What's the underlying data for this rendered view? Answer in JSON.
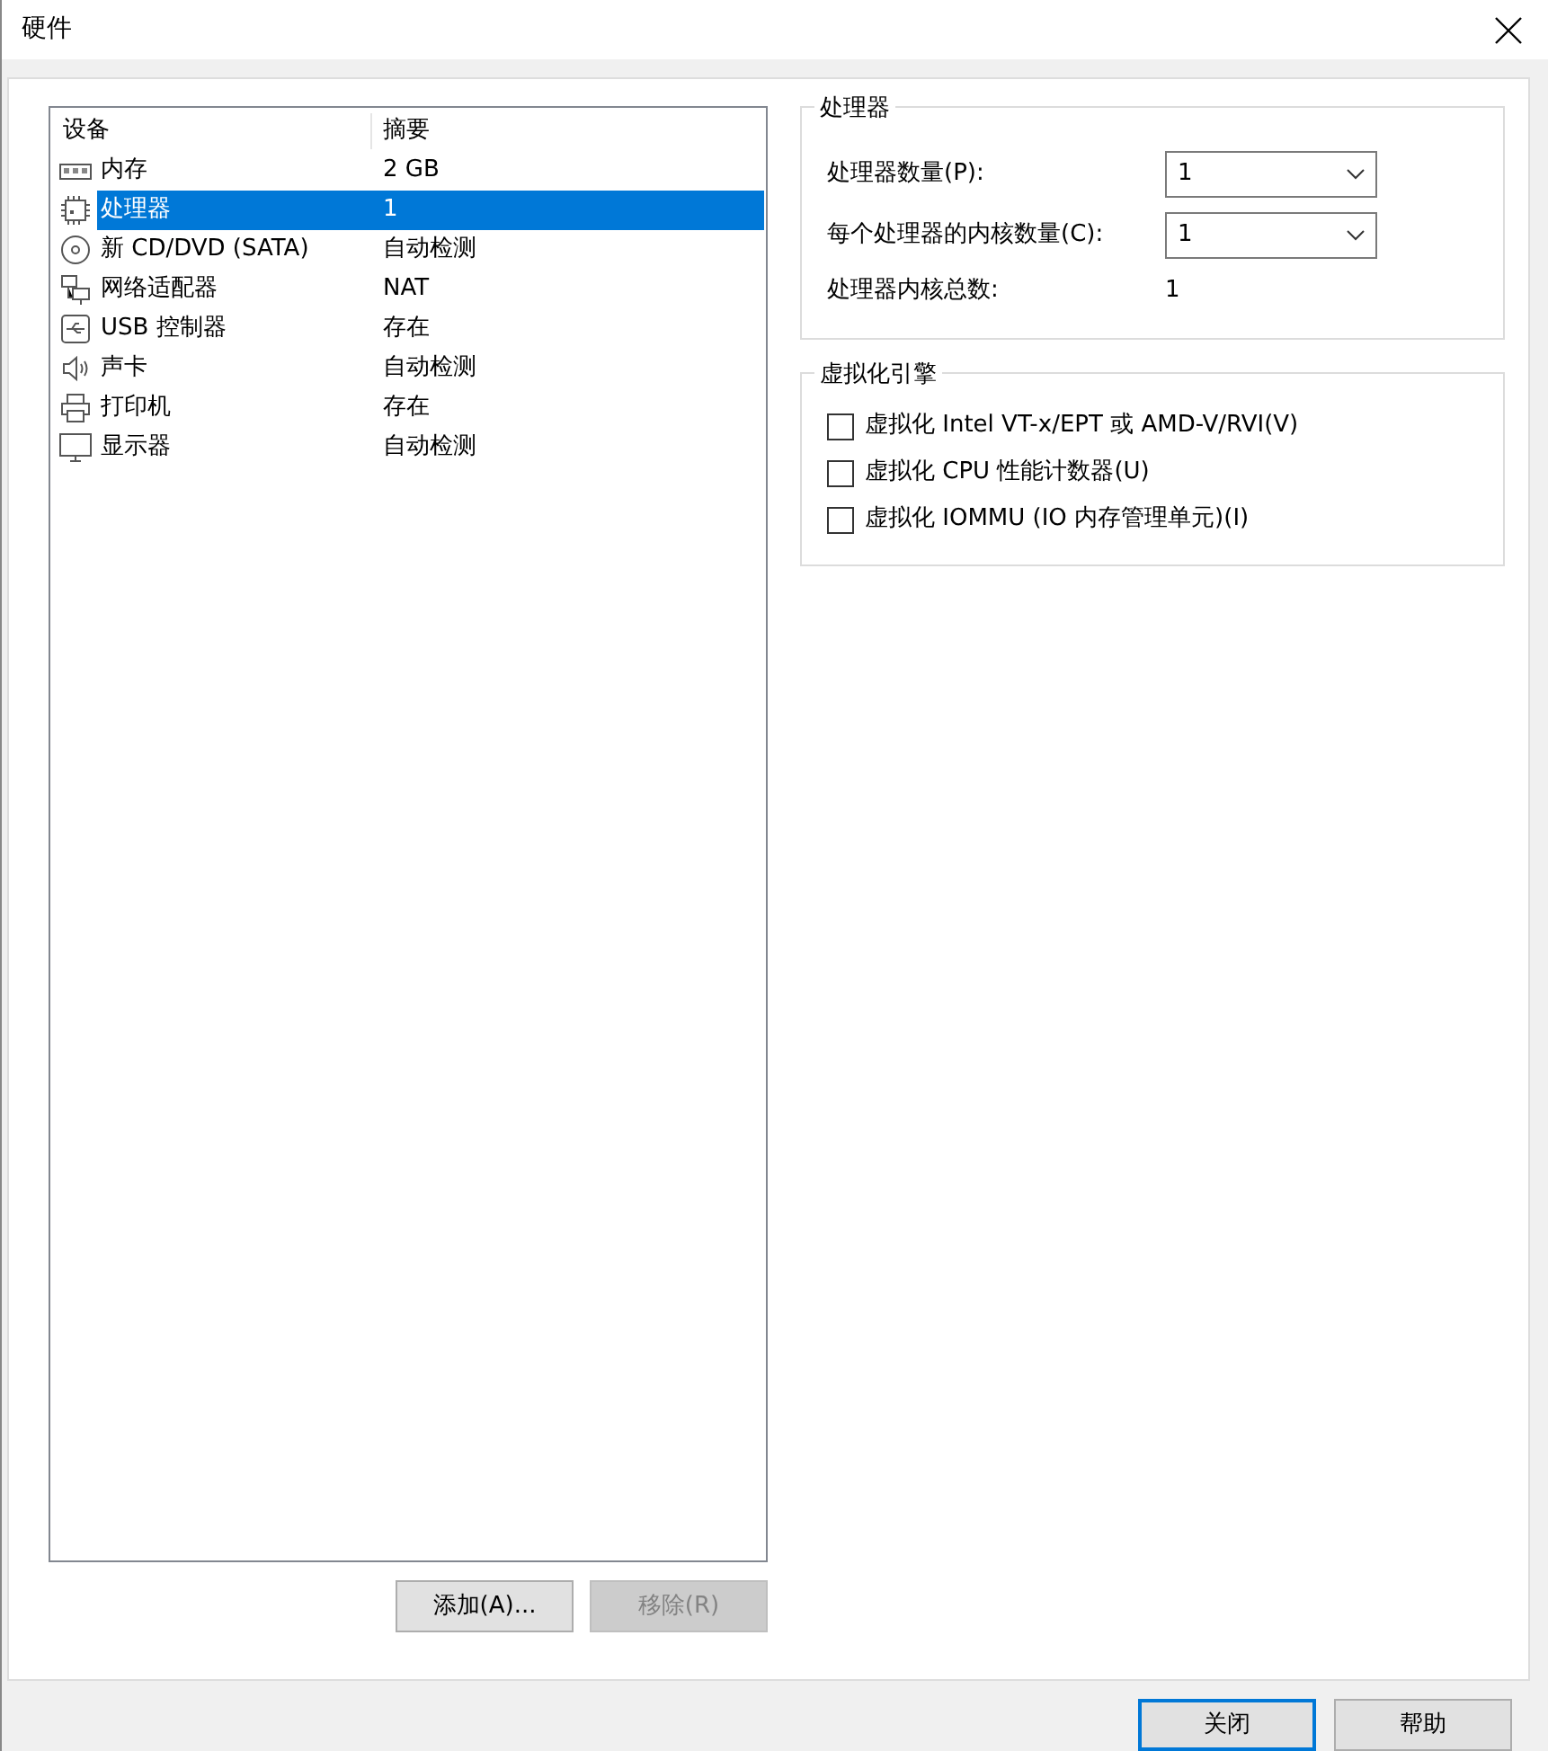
{
  "window": {
    "title": "硬件"
  },
  "devices": {
    "columns": [
      "设备",
      "摘要"
    ],
    "rows": [
      {
        "kind": "memory",
        "name": "内存",
        "summary": "2 GB",
        "selected": false
      },
      {
        "kind": "cpu",
        "name": "处理器",
        "summary": "1",
        "selected": true
      },
      {
        "kind": "disc",
        "name": "新 CD/DVD (SATA)",
        "summary": "自动检测",
        "selected": false
      },
      {
        "kind": "network",
        "name": "网络适配器",
        "summary": "NAT",
        "selected": false
      },
      {
        "kind": "usb",
        "name": "USB 控制器",
        "summary": "存在",
        "selected": false
      },
      {
        "kind": "sound",
        "name": "声卡",
        "summary": "自动检测",
        "selected": false
      },
      {
        "kind": "printer",
        "name": "打印机",
        "summary": "存在",
        "selected": false
      },
      {
        "kind": "display",
        "name": "显示器",
        "summary": "自动检测",
        "selected": false
      }
    ]
  },
  "list_buttons": [
    {
      "label": "添加(A)...",
      "disabled": false
    },
    {
      "label": "移除(R)",
      "disabled": true
    }
  ],
  "processor_group": {
    "title": "处理器",
    "selects": [
      {
        "label": "处理器数量(P):",
        "value": "1"
      },
      {
        "label": "每个处理器的内核数量(C):",
        "value": "1"
      }
    ],
    "total": {
      "label": "处理器内核总数:",
      "value": "1"
    }
  },
  "virtualization_group": {
    "title": "虚拟化引擎",
    "options": [
      {
        "label": "虚拟化 Intel VT-x/EPT 或 AMD-V/RVI(V)",
        "checked": false
      },
      {
        "label": "虚拟化 CPU 性能计数器(U)",
        "checked": false
      },
      {
        "label": "虚拟化 IOMMU (IO 内存管理单元)(I)",
        "checked": false
      }
    ]
  },
  "footer_buttons": [
    {
      "label": "关闭",
      "focused": true
    },
    {
      "label": "帮助",
      "focused": false
    }
  ]
}
